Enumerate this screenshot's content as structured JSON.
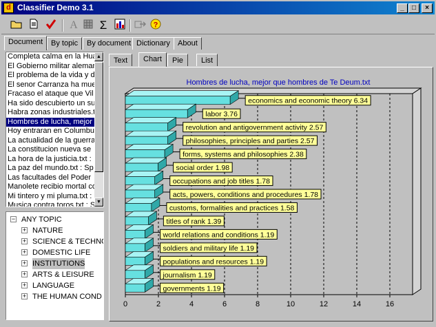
{
  "window": {
    "title": "Classifier Demo 3.1",
    "buttons": [
      "_",
      "□",
      "×"
    ]
  },
  "toolbar": {
    "icons": [
      "open-folder-icon",
      "new-document-icon",
      "check-icon",
      "font-icon",
      "grid-icon",
      "sigma-icon",
      "chart-icon",
      "export-icon",
      "help-icon"
    ]
  },
  "left_tabs": [
    "Document",
    "By topic",
    "By document",
    "Dictionary",
    "About"
  ],
  "documents": [
    "Completa calma en la Hua",
    "El Gobierno militar aleman",
    "El problema de la vida y d",
    "El senor Carranza ha mue",
    "Fracaso el ataque que Vil",
    "Ha sido descubierto un su",
    "Habra zonas industriales.t",
    "Hombres de lucha, mejor",
    "Hoy entraran en Columbu",
    "La actualidad de la guerra",
    "La constitucion nueva se",
    "La hora de la justicia.txt :",
    "La paz del mundo.txt : Sp",
    "Las facultades del Poder",
    "Manolete recibio mortal co",
    "Mi tintero y mi pluma.txt :",
    "Musica contra toros.txt : S"
  ],
  "selected_document_index": 7,
  "tree": {
    "root": "ANY TOPIC",
    "root_toggle": "−",
    "child_toggle": "+",
    "children": [
      "NATURE",
      "SCIENCE & TECHNO",
      "DOMESTIC LIFE",
      "INSTITUTIONS",
      "ARTS & LEISURE",
      "LANGUAGE",
      "THE HUMAN COND"
    ],
    "highlighted_index": 3
  },
  "right_tabs": [
    "Text",
    "Chart",
    "Pie",
    "List"
  ],
  "active_right_tab": "Chart",
  "chart_data": {
    "type": "bar",
    "orientation": "horizontal",
    "title": "Hombres de lucha, mejor que hombres de Te Deum.txt",
    "categories": [
      "economics and economic theory",
      "labor",
      "revolution and antigovernment activity",
      "philosophies, principles and parties",
      "forms, systems and philosophies",
      "social order",
      "occupations and job titles",
      "acts, powers, conditions and procedures",
      "customs, formalities and practices",
      "titles of rank",
      "world relations and conditions",
      "soldiers and military life",
      "populations and resources",
      "journalism",
      "governments"
    ],
    "values": [
      6.34,
      3.76,
      2.57,
      2.57,
      2.38,
      1.98,
      1.78,
      1.78,
      1.58,
      1.39,
      1.19,
      1.19,
      1.19,
      1.19,
      1.19
    ],
    "data_labels": [
      "economics and economic theory 6.34",
      "labor 3.76",
      "revolution and antigovernment activity 2.57",
      "philosophies, principles and parties 2.57",
      "forms, systems and philosophies 2.38",
      "social order 1.98",
      "occupations and job titles 1.78",
      "acts, powers, conditions and procedures 1.78",
      "customs, formalities and practices 1.58",
      "titles of rank 1.39",
      "world relations and conditions 1.19",
      "soldiers and military life 1.19",
      "populations and resources 1.19",
      "journalism 1.19",
      "governments 1.19"
    ],
    "xlim": [
      0,
      17
    ],
    "xticks": [
      0,
      2,
      4,
      6,
      8,
      10,
      12,
      14,
      16
    ],
    "grid": "vertical dashed",
    "colors": {
      "bar": "#66e0e0",
      "bar_side": "#30a8a8",
      "bar_top": "#a8f4f4",
      "label_bg": "#ffff99",
      "title": "#0000c0",
      "plot_bg": "#c0c0c0"
    }
  }
}
